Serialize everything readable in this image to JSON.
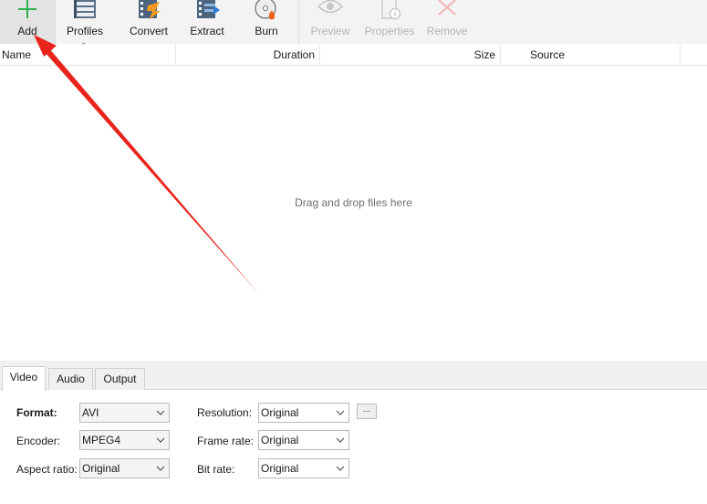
{
  "toolbar": {
    "add": "Add",
    "profiles": "Profiles",
    "convert": "Convert",
    "extract": "Extract",
    "burn": "Burn",
    "preview": "Preview",
    "properties": "Properties",
    "remove": "Remove"
  },
  "list": {
    "columns": {
      "name": "Name",
      "duration": "Duration",
      "size": "Size",
      "source": "Source"
    },
    "empty_hint": "Drag and drop files here"
  },
  "tabs": [
    "Video",
    "Audio",
    "Output"
  ],
  "video": {
    "format_label": "Format:",
    "format_value": "AVI",
    "encoder_label": "Encoder:",
    "encoder_value": "MPEG4",
    "aspect_label": "Aspect ratio:",
    "aspect_value": "Original",
    "resolution_label": "Resolution:",
    "resolution_value": "Original",
    "framerate_label": "Frame rate:",
    "framerate_value": "Original",
    "bitrate_label": "Bit rate:",
    "bitrate_value": "Original",
    "more_button": "..."
  },
  "colors": {
    "annotation_arrow": "#e8241c",
    "add_icon": "#2fb24c",
    "disabled_icon": "#c8c8c8"
  }
}
